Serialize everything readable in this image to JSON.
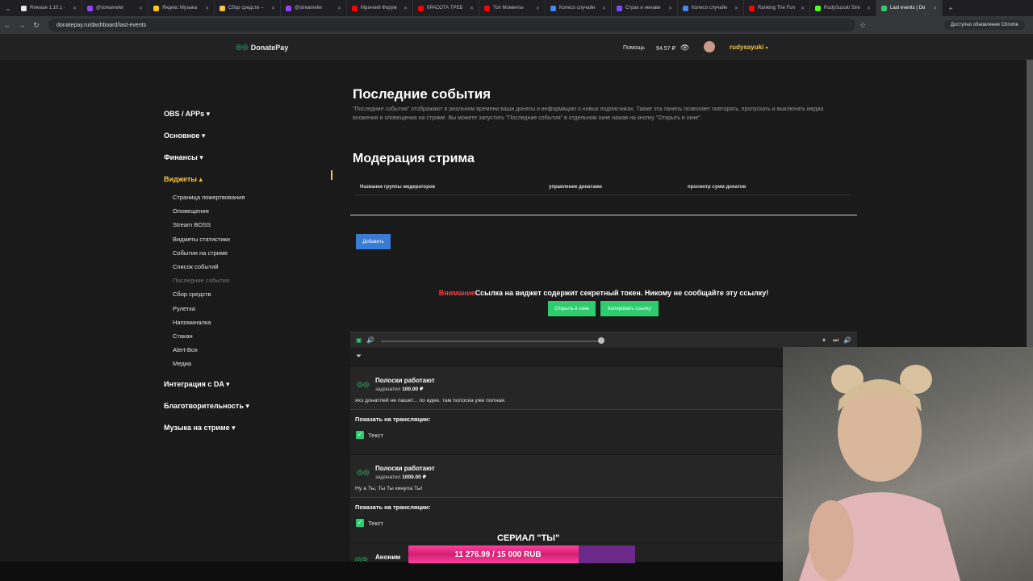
{
  "browser": {
    "tabs": [
      {
        "label": "Release 1.10.1 ·",
        "color": "#e8e8e8"
      },
      {
        "label": "@streameler",
        "color": "#9146ff"
      },
      {
        "label": "Яндекс Музыка",
        "color": "#ffcc00"
      },
      {
        "label": "Сбор средств –",
        "color": "#f5c542"
      },
      {
        "label": "@streameler",
        "color": "#9146ff"
      },
      {
        "label": "Мрачний Форум",
        "color": "#ff0000"
      },
      {
        "label": "КРАСОТА ТРЕБ",
        "color": "#ff0000"
      },
      {
        "label": "Топ Моменты",
        "color": "#ff0000"
      },
      {
        "label": "Колесо случайн",
        "color": "#4285f4"
      },
      {
        "label": "Страх и ненави",
        "color": "#7c4dff"
      },
      {
        "label": "Колесо случайн",
        "color": "#4285f4"
      },
      {
        "label": "Ranking The Fun",
        "color": "#ff0000"
      },
      {
        "label": "RudySuzuki Stre",
        "color": "#53fc18"
      },
      {
        "label": "Last events | Do",
        "color": "#2ecc71"
      }
    ],
    "url": "donatepay.ru/dashboard/last-events",
    "update_label": "Доступно обновление Chrome"
  },
  "header": {
    "logo": "DonatePay",
    "help": "Помощь",
    "balance": "94.57 ₽",
    "username": "rudysayuki",
    "caret": "▾"
  },
  "sidebar": {
    "groups_top": [
      {
        "label": "OBS / APPs ▾"
      },
      {
        "label": "Основное ▾"
      },
      {
        "label": "Финансы ▾"
      }
    ],
    "open_group": "Виджеты ▴",
    "items": [
      "Страница пожертвования",
      "Оповещения",
      "Stream BOSS",
      "Виджеты статистики",
      "События на стриме",
      "Список событий",
      "Последние события",
      "Сбор средств",
      "Рулетка",
      "Напоминалка",
      "Стакан",
      "Alert-Box",
      "Медиа"
    ],
    "groups_bottom": [
      {
        "label": "Интеграция с DA ▾"
      },
      {
        "label": "Благотворительность ▾"
      },
      {
        "label": "Музыка на стриме ▾"
      }
    ]
  },
  "main": {
    "title": "Последние события",
    "description": "\"Последние события\" отображают в реальном времени ваши донаты и информацию о новых подписчиках. Также эта панель позволяет повторять, пропускать и выключать медиа вложения и оповещения на стриме. Вы можете запустить \"Последние события\" в отдельном окне нажав на кнопку \"Открыть в окне\".",
    "moderation_title": "Модерация стрима",
    "columns": [
      "Название группы модераторов",
      "управление донатами",
      "просмотр сумм донатов"
    ],
    "add_button": "Добавить",
    "warning_prefix": "Внимание",
    "warning_text": "Ссылка на виджет содержит секретный токен. Никому не сообщайте эту ссылку!",
    "open_window_button": "Открыть в окне",
    "copy_link_button": "Копировать ссылку"
  },
  "events": [
    {
      "name": "Полоски работают",
      "action": "задонатил",
      "amount": "100.00 ₽",
      "message": "яхз донатлей не пашет... по идее. там полоска уже полная.",
      "show_label": "Показать на трансляции:",
      "check_label": "Текст"
    },
    {
      "name": "Полоски работают",
      "action": "задонатил",
      "amount": "1000.00 ₽",
      "message": "Ну а Ты, Ты Ты кинула Ты!",
      "show_label": "Показать на трансляции:",
      "check_label": "Текст"
    }
  ],
  "overlay": {
    "serial": "СЕРИАЛ \"ТЫ\"",
    "goal_text": "11 276.99 / 15 000 RUB",
    "goal_progress": 0.752,
    "anon": "Аноним"
  }
}
